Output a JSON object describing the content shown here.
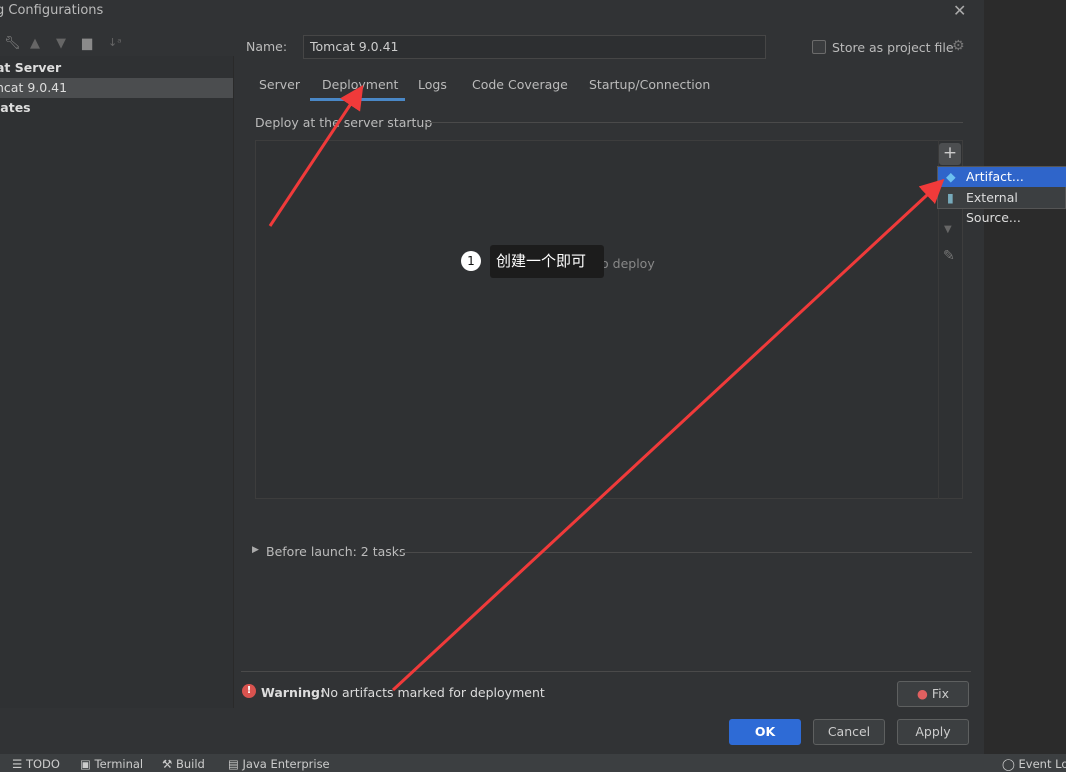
{
  "window": {
    "title": "g Configurations",
    "close_icon": "close-icon"
  },
  "left": {
    "toolbar": [
      "wrench-icon",
      "arrow-up-icon",
      "arrow-down-icon",
      "new-folder-icon",
      "sort-az-icon"
    ],
    "tree": [
      {
        "label": "at Server",
        "bold": true
      },
      {
        "label": "ncat 9.0.41",
        "selected": true
      },
      {
        "label": "lates",
        "bold": true
      }
    ]
  },
  "form": {
    "name_label": "Name:",
    "name_value": "Tomcat 9.0.41",
    "store_label": "Store as project file"
  },
  "tabs": [
    {
      "label": "Server"
    },
    {
      "label": "Deployment",
      "active": true
    },
    {
      "label": "Logs"
    },
    {
      "label": "Code Coverage"
    },
    {
      "label": "Startup/Connection"
    }
  ],
  "deploy": {
    "section_label": "Deploy at the server startup",
    "empty_text": "Nothing to deploy",
    "menu": [
      {
        "label": "Artifact...",
        "highlighted": true
      },
      {
        "label": "External Source..."
      }
    ]
  },
  "annotation": {
    "number": "1",
    "text": "创建一个即可",
    "arrow_color": "#f03a3a"
  },
  "before_launch": "Before launch: 2 tasks",
  "warning": {
    "label": "Warning:",
    "text": "No artifacts marked for deployment",
    "fix": "Fix"
  },
  "buttons": {
    "ok": "OK",
    "cancel": "Cancel",
    "apply": "Apply"
  },
  "statusbar": {
    "items": [
      "TODO",
      "Terminal",
      "Build",
      "Java Enterprise"
    ],
    "right": "Event Log"
  },
  "accent": "#2f65ca"
}
